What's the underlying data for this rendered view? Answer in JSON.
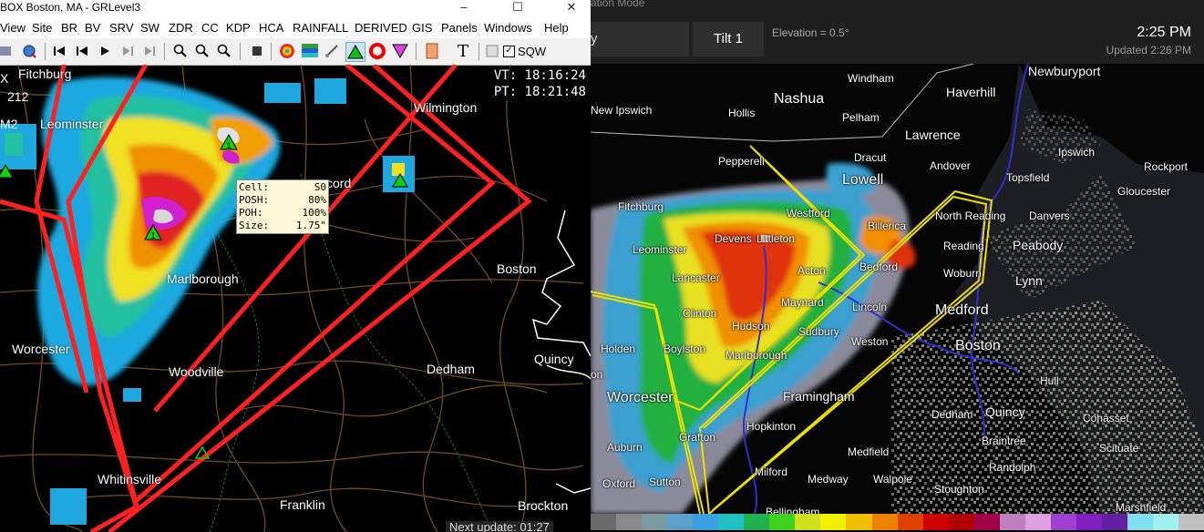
{
  "left_window": {
    "title": "BOX Boston, MA - GRLevel3",
    "window_controls": {
      "minimize": "–",
      "maximize": "☐",
      "close": "✕"
    },
    "menu": [
      "View",
      "Site",
      "BR",
      "BV",
      "SRV",
      "SW",
      "ZDR",
      "CC",
      "KDP",
      "HCA",
      "RAINFALL",
      "DERIVED",
      "GIS",
      "Panels",
      "Windows",
      "Help"
    ],
    "toolbar": {
      "sqw_label": "SQW",
      "sqw_checked": "✓"
    },
    "station_partial": {
      "line1": "X",
      "line2": "212",
      "line3": "M2"
    },
    "time_readout": {
      "vt": "VT: 18:16:24",
      "pt": "PT: 18:21:48"
    },
    "cell_info": [
      {
        "k": "Cell:",
        "v": "S0"
      },
      {
        "k": "POSH:",
        "v": "80%"
      },
      {
        "k": "POH:",
        "v": "100%"
      },
      {
        "k": "Size:",
        "v": "1.75\""
      }
    ],
    "next_update": "Next update: 01:27",
    "place_labels": {
      "fitchburg": "Fitchburg",
      "leominster": "Leominster",
      "wilmington": "Wilmington",
      "concord": "cord",
      "marlborough": "Marlborough",
      "boston": "Boston",
      "worcester": "Worcester",
      "woodville": "Woodville",
      "dedham": "Dedham",
      "quincy": "Quincy",
      "whitinsville": "Whitinsville",
      "franklin": "Franklin",
      "brockton": "Brockton"
    },
    "hail_marker_symbol": "1"
  },
  "right_window": {
    "mode_text": "ation Mode",
    "tab_fragment": "y",
    "tilt_label": "Tilt 1",
    "elevation": "Elevation = 0.5°",
    "time": "2:25 PM",
    "updated": "Updated 2:26 PM",
    "place_labels": {
      "newburyport": "Newburyport",
      "windham": "Windham",
      "nashua": "Nashua",
      "haverhill": "Haverhill",
      "new_ipswich": "New Ipswich",
      "hollis": "Hollis",
      "pelham": "Pelham",
      "lawrence": "Lawrence",
      "ipswich": "Ipswich",
      "pepperell": "Pepperell",
      "dracut": "Dracut",
      "andover": "Andover",
      "rockport": "Rockport",
      "lowell": "Lowell",
      "topsfield": "Topsfield",
      "gloucester": "Gloucester",
      "fitchburg": "Fitchburg",
      "westford": "Westford",
      "billerica": "Billerica",
      "north_reading": "North Reading",
      "danvers": "Danvers",
      "leominster": "Leominster",
      "devens": "Devens",
      "littleton": "Littleton",
      "reading": "Reading",
      "peabody": "Peabody",
      "lancaster": "Lancaster",
      "acton": "Acton",
      "bedford": "Bedford",
      "woburn": "Woburn",
      "lynn": "Lynn",
      "clinton": "Clinton",
      "maynard": "Maynard",
      "lincoln": "Lincoln",
      "medford": "Medford",
      "hudson": "Hudson",
      "holden": "Holden",
      "sudbury": "Sudbury",
      "boylston": "Boylston",
      "weston": "Weston",
      "boston": "Boston",
      "marlborough": "Marlborough",
      "on": "on",
      "hull": "Hull",
      "worcester": "Worcester",
      "framingham": "Framingham",
      "dedham": "Dedham",
      "quincy": "Quincy",
      "cohasset": "Cohasset",
      "grafton": "Grafton",
      "hopkinton": "Hopkinton",
      "braintree": "Braintree",
      "auburn": "Auburn",
      "medfield": "Medfield",
      "scituate": "Scituate",
      "randolph": "Randolph",
      "milford": "Milford",
      "oxford": "Oxford",
      "sutton": "Sutton",
      "medway": "Medway",
      "walpole": "Walpole",
      "stoughton": "Stoughton",
      "marshfield": "Marshfield",
      "bellingham": "Bellingham"
    },
    "colorbar": [
      "#6b6b6b",
      "#8a8a8a",
      "#7a9aa0",
      "#5aa0c8",
      "#3aa0e0",
      "#20c0c0",
      "#20b050",
      "#40d020",
      "#d0e020",
      "#f0f000",
      "#f0c000",
      "#f08000",
      "#e04000",
      "#d00000",
      "#b00000",
      "#a0004a",
      "#c080c0",
      "#e0a0e0",
      "#a040d0",
      "#8020c0",
      "#6020a0",
      "#80e0f0",
      "#a0f0f0",
      "#c0c0c0"
    ]
  }
}
